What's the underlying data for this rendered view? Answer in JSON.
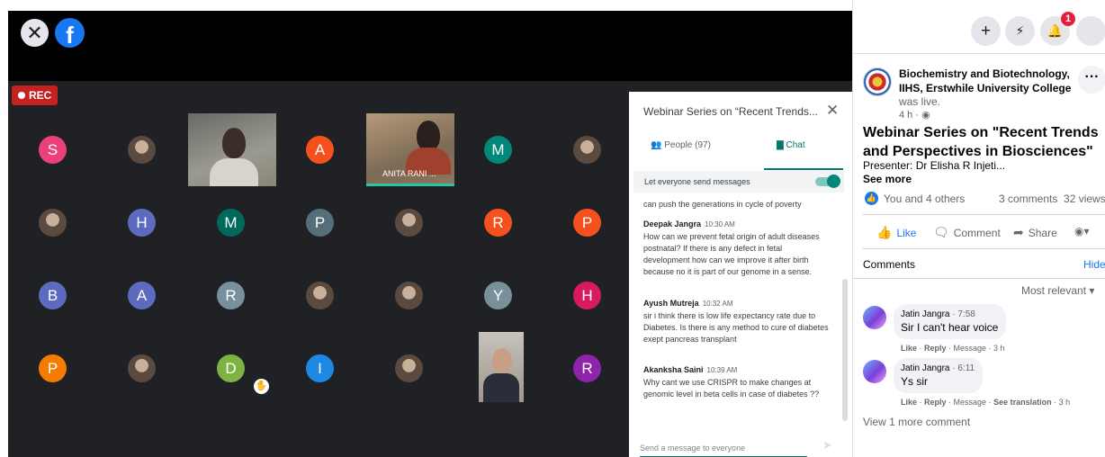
{
  "fb_overlay": {
    "close_icon": "close-icon",
    "logo_text": "f"
  },
  "meeting": {
    "rec_label": "REC",
    "grid": [
      {
        "t": "a",
        "letter": "S",
        "color": "#ec407a"
      },
      {
        "t": "p"
      },
      {
        "t": "cam"
      },
      {
        "t": "a",
        "letter": "A",
        "color": "#f4511e"
      },
      {
        "t": "anita",
        "name": "ANITA RANI ..."
      },
      {
        "t": "a",
        "letter": "M",
        "color": "#00897b"
      },
      {
        "t": "p"
      },
      {
        "t": "p"
      },
      {
        "t": "a",
        "letter": "H",
        "color": "#5c6bc0"
      },
      {
        "t": "a",
        "letter": "M",
        "color": "#00695c"
      },
      {
        "t": "a",
        "letter": "P",
        "color": "#546e7a"
      },
      {
        "t": "p"
      },
      {
        "t": "a",
        "letter": "R",
        "color": "#f4511e"
      },
      {
        "t": "a",
        "letter": "P",
        "color": "#f4511e"
      },
      {
        "t": "a",
        "letter": "B",
        "color": "#5c6bc0"
      },
      {
        "t": "a",
        "letter": "A",
        "color": "#5c6bc0"
      },
      {
        "t": "a",
        "letter": "R",
        "color": "#78909c"
      },
      {
        "t": "p"
      },
      {
        "t": "p"
      },
      {
        "t": "a",
        "letter": "Y",
        "color": "#78909c"
      },
      {
        "t": "a",
        "letter": "H",
        "color": "#d81b60"
      },
      {
        "t": "a",
        "letter": "P",
        "color": "#f57c00"
      },
      {
        "t": "p"
      },
      {
        "t": "a",
        "letter": "D",
        "color": "#7cb342",
        "hand": true
      },
      {
        "t": "a",
        "letter": "I",
        "color": "#1e88e5"
      },
      {
        "t": "p"
      },
      {
        "t": "tall"
      },
      {
        "t": "a",
        "letter": "R",
        "color": "#8e24aa"
      }
    ]
  },
  "chat": {
    "title": "Webinar Series on “Recent Trends...",
    "people_label": "People (97)",
    "chat_label": "Chat",
    "toggle_label": "Let everyone send messages",
    "continued_text": "can push the generations in cycle of poverty",
    "messages": [
      {
        "sender": "Deepak Jangra",
        "time": "10:30 AM",
        "text": "How can we prevent fetal origin of adult diseases postnatal? If there is any defect in fetal development how can we improve it after birth because no it is part of our genome in a sense."
      },
      {
        "sender": "Ayush Mutreja",
        "time": "10:32 AM",
        "text": "sir i think there is low life expectancy rate due to Diabetes. Is there is any method to  cure of diabetes exept pancreas transplant"
      },
      {
        "sender": "Akanksha Saini",
        "time": "10:39 AM",
        "text": "Why cant we use CRISPR to make changes at genomic level in beta cells in case of diabetes ??"
      }
    ],
    "input_placeholder": "Send a message to everyone"
  },
  "sidebar": {
    "notif_count": "1",
    "page_name": "Biochemistry and Biotechnology, IIHS, Erstwhile University College",
    "was_live": "was live.",
    "post_time": "4 h · ",
    "post_title": "Webinar Series on \"Recent Trends and Perspectives in Biosciences\"",
    "presenter": "Presenter: Dr Elisha R Injeti...",
    "see_more": "See more",
    "reactions_text": "You and 4 others",
    "comments_count": "3 comments",
    "views_count": "32 views",
    "like_label": "Like",
    "comment_label": "Comment",
    "share_label": "Share",
    "comments_heading": "Comments",
    "hide_label": "Hide",
    "sort_label": "Most relevant",
    "comments": [
      {
        "name": "Jatin Jangra",
        "time": "7:58",
        "text": "Sir I can't hear voice",
        "like": "Like",
        "reply": "Reply",
        "meta": "Message · 3 h",
        "translation": ""
      },
      {
        "name": "Jatin Jangra",
        "time": "6:11",
        "text": "Ys sir",
        "like": "Like",
        "reply": "Reply",
        "meta": "Message · ",
        "translation": "See translation"
      }
    ],
    "translation_time": " · 3 h",
    "view_more": "View 1 more comment"
  }
}
